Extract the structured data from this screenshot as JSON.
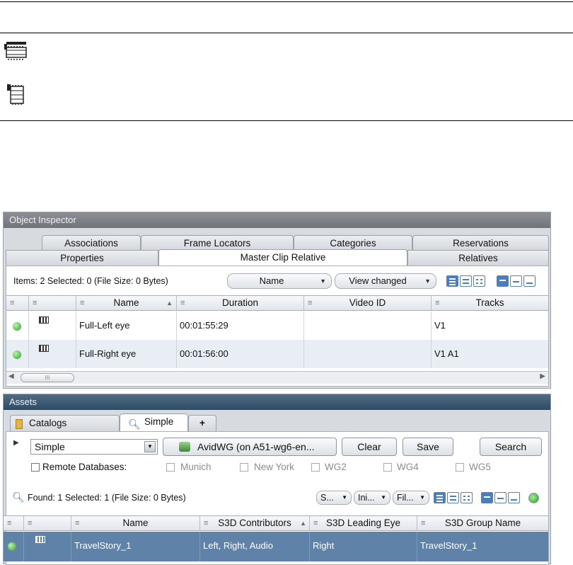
{
  "object_inspector": {
    "title": "Object Inspector",
    "tabs_row1": [
      "Associations",
      "Frame Locators",
      "Categories",
      "Reservations"
    ],
    "tabs_row2": [
      "Properties",
      "Master Clip Relative",
      "Relatives"
    ],
    "status": "Items: 2 Selected: 0 (File Size: 0 Bytes)",
    "sort_by": "Name",
    "view_filter": "View changed",
    "columns": [
      "Name",
      "Duration",
      "Video ID",
      "Tracks"
    ],
    "rows": [
      {
        "name": "Full-Left eye",
        "duration": "00:01:55:29",
        "video_id": "",
        "tracks": "V1"
      },
      {
        "name": "Full-Right eye",
        "duration": "00:01:56:00",
        "video_id": "",
        "tracks": "V1 A1"
      }
    ],
    "scroll_thumb": "III"
  },
  "assets": {
    "title": "Assets",
    "tabs": [
      "Catalogs",
      "Simple",
      "+"
    ],
    "search_type": "Simple",
    "workgroup": "AvidWG (on A51-wg6-en...",
    "clear_label": "Clear",
    "save_label": "Save",
    "search_label": "Search",
    "remote_label": "Remote Databases:",
    "databases": [
      "Munich",
      "New York",
      "WG2",
      "WG4",
      "WG5"
    ],
    "status": "Found: 1 Selected: 1 (File Size: 0 Bytes)",
    "mini_filters": [
      "S...",
      "Ini...",
      "Fil..."
    ],
    "columns": [
      "Name",
      "S3D Contributors",
      "S3D Leading Eye",
      "S3D Group Name"
    ],
    "rows": [
      {
        "name": "TravelStory_1",
        "contributors": "Left, Right, Audio",
        "leading_eye": "Right",
        "group_name": "TravelStory_1"
      }
    ]
  },
  "colors": {
    "selection": "#5f83a8",
    "assets_title": "#2f4b63",
    "status_green": "#2f9c2f"
  }
}
